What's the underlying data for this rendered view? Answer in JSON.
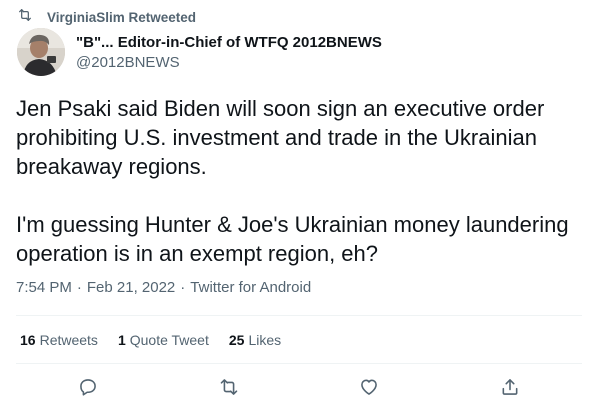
{
  "retweet_context": {
    "text": "VirginiaSlim Retweeted",
    "icon": "retweet-icon"
  },
  "author": {
    "name": "\"B\"... Editor-in-Chief of WTFQ 2012BNEWS",
    "handle": "@2012BNEWS"
  },
  "tweet": {
    "paragraphs": [
      "Jen Psaki said Biden will soon sign an executive order prohibiting U.S. investment and trade in the Ukrainian breakaway regions.",
      "I'm guessing Hunter & Joe's Ukrainian money laundering operation is in an exempt region, eh?"
    ]
  },
  "meta": {
    "time": "7:54 PM",
    "date": "Feb 21, 2022",
    "source": "Twitter for Android",
    "separator": "·"
  },
  "stats": {
    "retweets": {
      "count": "16",
      "label": "Retweets"
    },
    "quotes": {
      "count": "1",
      "label": "Quote Tweet"
    },
    "likes": {
      "count": "25",
      "label": "Likes"
    }
  },
  "actions": {
    "reply_icon": "reply-icon",
    "retweet_icon": "retweet-icon",
    "like_icon": "heart-icon",
    "share_icon": "share-icon"
  },
  "colors": {
    "text_primary": "#0f1419",
    "text_secondary": "#536471",
    "divider": "#eff3f4"
  }
}
